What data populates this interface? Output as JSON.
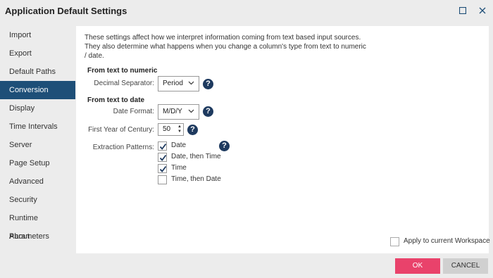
{
  "window": {
    "title": "Application Default Settings"
  },
  "sidebar": {
    "items": [
      {
        "label": "Import",
        "active": false
      },
      {
        "label": "Export",
        "active": false
      },
      {
        "label": "Default Paths",
        "active": false
      },
      {
        "label": "Conversion",
        "active": true
      },
      {
        "label": "Display",
        "active": false
      },
      {
        "label": "Time Intervals",
        "active": false
      },
      {
        "label": "Server",
        "active": false
      },
      {
        "label": "Page Setup",
        "active": false
      },
      {
        "label": "Advanced",
        "active": false
      },
      {
        "label": "Security",
        "active": false
      },
      {
        "label": "Runtime Parameters",
        "active": false
      },
      {
        "label": "About",
        "active": false
      }
    ]
  },
  "main": {
    "description": "These settings affect how we interpret information coming from text based input sources.  They also determine what happens when you change a column's type from text to numeric / date.",
    "numeric": {
      "heading": "From text to numeric",
      "decimal_label": "Decimal Separator:",
      "decimal_value": "Period"
    },
    "date": {
      "heading": "From text to date",
      "format_label": "Date Format:",
      "format_value": "M/D/Y",
      "century_label": "First Year of Century:",
      "century_value": "50",
      "patterns_label": "Extraction Patterns:",
      "patterns": [
        {
          "label": "Date",
          "checked": true
        },
        {
          "label": "Date, then Time",
          "checked": true
        },
        {
          "label": "Time",
          "checked": true
        },
        {
          "label": "Time, then Date",
          "checked": false
        }
      ]
    },
    "apply_label": "Apply to current Workspace",
    "apply_checked": false
  },
  "footer": {
    "ok_label": "OK",
    "cancel_label": "CANCEL"
  },
  "colors": {
    "accent": "#1e4f78",
    "ok_button": "#e9426b",
    "help_icon": "#1e3a5f",
    "check": "#1e3a5f"
  },
  "icons": {
    "maximize": "maximize-icon",
    "close": "close-icon",
    "help": "help-icon",
    "chevron": "chevron-down-icon",
    "stepper": "stepper-arrows-icon"
  }
}
